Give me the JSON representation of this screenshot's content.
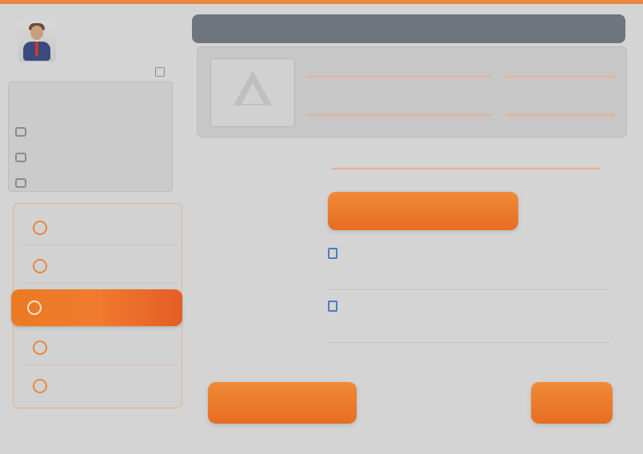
{
  "colors": {
    "accent": "#e8873e",
    "accent_dark": "#e56e22",
    "sidebar_bg": "#d4d4d4",
    "header_bg": "#6f757d",
    "link": "#3f6fbf"
  },
  "sidebar": {
    "profile": {
      "name": "",
      "role": ""
    },
    "logout_label": "",
    "panel_title": "",
    "panel_items": [
      {
        "label": "",
        "icon": "calendar-icon"
      },
      {
        "label": "",
        "icon": "document-icon"
      },
      {
        "label": "",
        "icon": "bank-icon"
      }
    ],
    "menu_items": [
      {
        "label": "",
        "icon": "circle-icon"
      },
      {
        "label": "",
        "icon": "circle-icon"
      },
      {
        "label": "",
        "icon": "circle-icon"
      },
      {
        "label": "",
        "icon": "circle-icon"
      }
    ],
    "active_item": {
      "label": "",
      "icon": "circle-icon"
    }
  },
  "main": {
    "header_title": "",
    "fields": [
      {
        "label": ""
      },
      {
        "label": ""
      },
      {
        "label": ""
      },
      {
        "label": ""
      }
    ],
    "form_row": {
      "label": "",
      "value": ""
    },
    "primary_button_label": "",
    "list": [
      {
        "title": "",
        "subtitle": "",
        "meta": "",
        "icon": "document-icon"
      },
      {
        "title": "",
        "subtitle": "",
        "meta": "",
        "icon": "document-icon"
      }
    ],
    "bottom_left_label": "",
    "bottom_right_label": ""
  }
}
